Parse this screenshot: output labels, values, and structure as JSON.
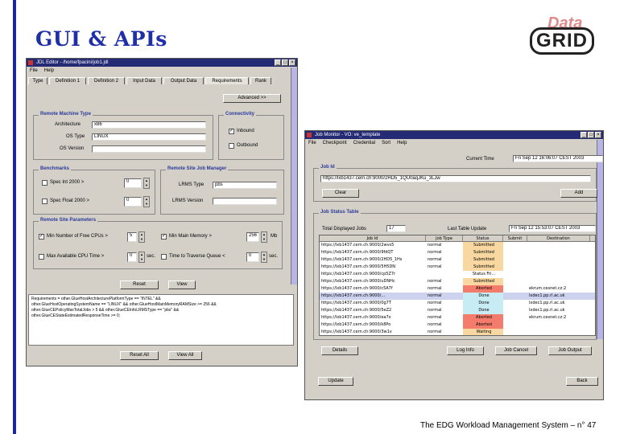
{
  "slide": {
    "title": "GUI & APIs",
    "footer": "The EDG Workload Management System – n° 47",
    "logo_top": "Data",
    "logo_main": "GRID",
    "accent_color": "#1f2fa8"
  },
  "jdl_editor": {
    "title": "JDL Editor - /home/fpacini/job1.jdl",
    "menu": [
      "File",
      "Help"
    ],
    "tabs": [
      "Type",
      "Definition 1",
      "Definition 2",
      "Input Data",
      "Output Data",
      "Requirements",
      "Rank"
    ],
    "advanced_button": "Advanced >>",
    "remote_machine_type": {
      "title": "Remote Machine Type",
      "architecture_label": "Architecture",
      "architecture_value": "x86",
      "os_type_label": "OS Type",
      "os_type_value": "LINUX",
      "os_version_label": "OS Version",
      "os_version_value": ""
    },
    "connectivity": {
      "title": "Connectivity",
      "inbound_label": "Inbound",
      "outbound_label": "Outbound"
    },
    "benchmarks": {
      "title": "Benchmarks",
      "spec_int_label": "Spec Int 2000 >",
      "spec_int_value": "0",
      "spec_float_label": "Spec Float 2000 >",
      "spec_float_value": "0"
    },
    "remote_site_job_manager": {
      "title": "Remote Site Job Manager",
      "lrms_type_label": "LRMS Type",
      "lrms_type_value": "pbs",
      "lrms_version_label": "LRMS Version",
      "lrms_version_value": ""
    },
    "remote_site_parameters": {
      "title": "Remote Site Parameters",
      "min_cpus_label": "Min Number of Free CPUs >",
      "min_cpus_value": "5",
      "min_memory_label": "Min Main Memory >",
      "min_memory_value": "256",
      "min_memory_unit": "Mb",
      "max_cpu_time_label": "Max Available CPU Time >",
      "max_cpu_time_value": "0",
      "max_cpu_time_unit": "sec.",
      "time_to_traverse_label": "Time to Traverse Queue <",
      "time_to_traverse_value": "0",
      "time_to_traverse_unit": "sec."
    },
    "reset_button": "Reset",
    "view_button": "View",
    "requirements_text": [
      "Requirements = other.GlueHostArchitecturePlatformType == \"INTEL\" &&",
      "other.GlueHostOperatingSystemName == \"LINUX\" && other.GlueHostMainMemoryRAMSize >= 256 &&",
      "other.GlueCEPolicyMaxTotalJobs > 5 && other.GlueCEInfoLRMSType == \"pbs\" &&",
      "other.GlueCEStateEstimatedResponseTime >= 0;"
    ],
    "reset_all_button": "Reset All",
    "view_all_button": "View All"
  },
  "job_monitor": {
    "title": "Job Monitor - VO: ve_template",
    "menu": [
      "File",
      "Checkpoint",
      "Credential",
      "Sort",
      "Help"
    ],
    "current_time_label": "Current Time",
    "current_time_value": "Fri Sep 12 16:06:07 CEST 2003",
    "job_id_group": "Job Id",
    "job_id_value": "https://lxb1437.cern.ch:9000/2HD5_1QU0aqJKu_3LJw",
    "clear_button": "Clear",
    "add_button": "Add",
    "job_status_group": "Job Status Table",
    "total_displayed_label": "Total Displayed Jobs",
    "total_displayed_value": "17",
    "last_update_label": "Last Table Update",
    "last_update_value": "Fri Sep 12 15:53:07 CEST 2003",
    "columns": [
      "Job Id",
      "Job Type",
      "Status",
      "Submit",
      "Destination"
    ],
    "rows": [
      {
        "id": "https://lxb1437.cern.ch:9000/2wvs5",
        "type": "normal",
        "status": "Submitted",
        "submit": "",
        "dest": "",
        "cls": "st-sub"
      },
      {
        "id": "https://lxb1437.cern.ch:9000/9fdQT",
        "type": "normal",
        "status": "Submitted",
        "submit": "",
        "dest": "",
        "cls": "st-sub"
      },
      {
        "id": "https://lxb1437.cern.ch:9000/2HD5_1Hs",
        "type": "normal",
        "status": "Submitted",
        "submit": "",
        "dest": "",
        "cls": "st-sub"
      },
      {
        "id": "https://lxb1437.cern.ch:9000/5H5DN",
        "type": "normal",
        "status": "Submitted",
        "submit": "",
        "dest": "",
        "cls": "st-sub"
      },
      {
        "id": "https://lxb1437.cern.ch:9000/cp5Z7r",
        "type": "",
        "status": "Status Fri...",
        "submit": "",
        "dest": "",
        "cls": ""
      },
      {
        "id": "https://lxb1437.cern.ch:9000/uDNHc",
        "type": "normal",
        "status": "Submitted",
        "submit": "",
        "dest": "",
        "cls": "st-sub"
      },
      {
        "id": "https://lxb1437.cern.ch:9000/c5A7f",
        "type": "normal",
        "status": "Aborted",
        "submit": "",
        "dest": "ekrum.cesnet.cz:2",
        "cls": "st-abo"
      },
      {
        "id": "https://lxb1437.cern.ch:9000/...",
        "type": "normal",
        "status": "Done",
        "submit": "",
        "dest": "lxdec1.pp.rl.ac.uk",
        "cls": "st-done",
        "sel": true
      },
      {
        "id": "https://lxb1437.cern.ch:9000/0g7T",
        "type": "normal",
        "status": "Done",
        "submit": "",
        "dest": "lxdec1.pp.rl.ac.uk",
        "cls": "st-done"
      },
      {
        "id": "https://lxb1437.cern.ch:9000/5eZ2",
        "type": "normal",
        "status": "Done",
        "submit": "",
        "dest": "lxdec1.pp.rl.ac.uk",
        "cls": "st-done"
      },
      {
        "id": "https://lxb1437.cern.ch:9000/ea7x",
        "type": "normal",
        "status": "Aborted",
        "submit": "",
        "dest": "ekrum.cesnet.cz:2",
        "cls": "st-abo"
      },
      {
        "id": "https://lxb1437.cern.ch:9000/k8Po",
        "type": "normal",
        "status": "Aborted",
        "submit": "",
        "dest": "",
        "cls": "st-abo"
      },
      {
        "id": "https://lxb1437.cern.ch:9000/3w1v",
        "type": "normal",
        "status": "Waiting",
        "submit": "",
        "dest": "",
        "cls": "st-wait"
      }
    ],
    "details_button": "Details",
    "log_info_button": "Log Info",
    "job_cancel_button": "Job Cancel",
    "job_output_button": "Job Output",
    "update_button": "Update",
    "back_button": "Back"
  }
}
